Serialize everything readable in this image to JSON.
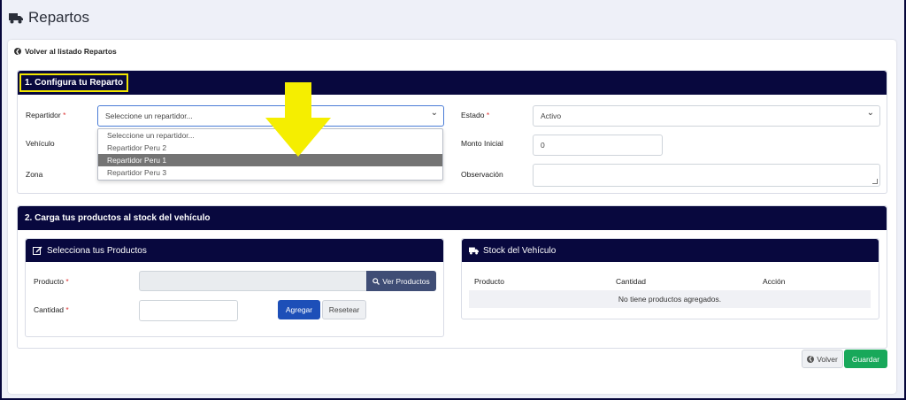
{
  "header": {
    "title": "Repartos",
    "icon": "truck-icon"
  },
  "back_link": {
    "label": "Volver al listado Repartos",
    "icon": "circle-arrow-left-icon"
  },
  "section1": {
    "title": "1. Configura tu Reparto",
    "repartidor": {
      "label": "Repartidor",
      "required": "*",
      "value": "Seleccione un repartidor...",
      "options": [
        "Seleccione un repartidor...",
        "Repartidor Peru 2",
        "Repartidor Peru 1",
        "Repartidor Peru 3"
      ],
      "highlighted": "Repartidor Peru 1"
    },
    "vehiculo": {
      "label": "Vehículo"
    },
    "zona": {
      "label": "Zona"
    },
    "estado": {
      "label": "Estado",
      "required": "*",
      "value": "Activo"
    },
    "monto_inicial": {
      "label": "Monto Inicial",
      "value": "0"
    },
    "observacion": {
      "label": "Observación",
      "value": ""
    }
  },
  "section2": {
    "title": "2. Carga tus productos al stock del vehículo",
    "productos_card": {
      "title": "Selecciona tus Productos",
      "icon": "edit-icon",
      "producto": {
        "label": "Producto",
        "required": "*",
        "value": ""
      },
      "ver_productos": {
        "label": "Ver Productos",
        "icon": "search-icon"
      },
      "cantidad": {
        "label": "Cantidad",
        "required": "*",
        "value": ""
      },
      "agregar": "Agregar",
      "resetear": "Resetear"
    },
    "stock_card": {
      "title": "Stock del Vehículo",
      "icon": "truck-icon",
      "columns": [
        "Producto",
        "Cantidad",
        "Acción"
      ],
      "empty_message": "No tiene productos agregados."
    }
  },
  "footer": {
    "volver": "Volver",
    "guardar": "Guardar"
  },
  "colors": {
    "navy": "#08083e",
    "highlight": "#f2e600",
    "arrow": "#f5ee00",
    "primary": "#1d4fb8",
    "success": "#18a85a"
  }
}
